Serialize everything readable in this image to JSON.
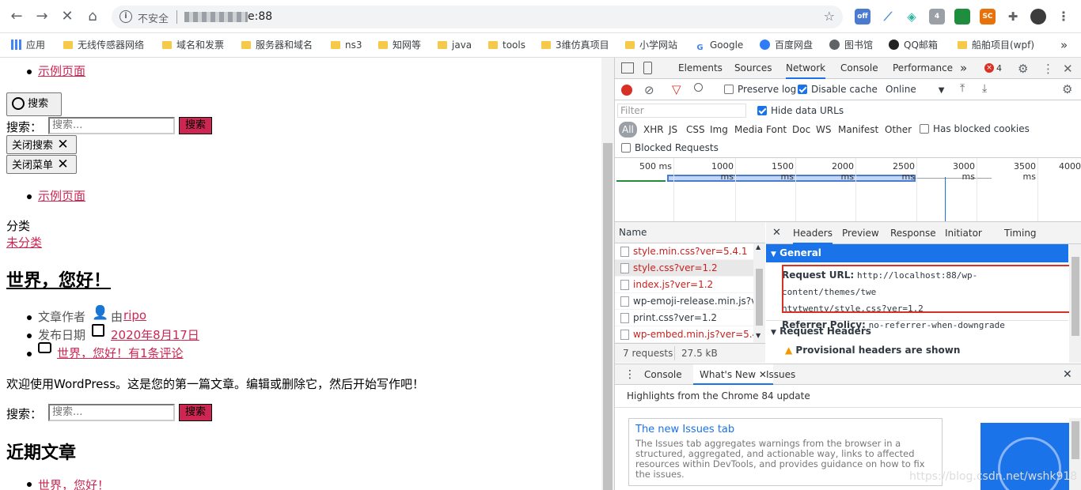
{
  "browser": {
    "insecure_label": "不安全",
    "url_visible": "e:88",
    "bookmarks": [
      {
        "label": "应用",
        "kind": "apps"
      },
      {
        "label": "无线传感器网络",
        "kind": "folder"
      },
      {
        "label": "域名和发票",
        "kind": "folder"
      },
      {
        "label": "服务器和域名",
        "kind": "folder"
      },
      {
        "label": "ns3",
        "kind": "folder"
      },
      {
        "label": "知网等",
        "kind": "folder"
      },
      {
        "label": "java",
        "kind": "folder"
      },
      {
        "label": "tools",
        "kind": "folder"
      },
      {
        "label": "3维仿真项目",
        "kind": "folder"
      },
      {
        "label": "小学网站",
        "kind": "folder"
      },
      {
        "label": "Google",
        "kind": "google"
      },
      {
        "label": "百度网盘",
        "kind": "baidu"
      },
      {
        "label": "图书馆",
        "kind": "globe"
      },
      {
        "label": "QQ邮箱",
        "kind": "qq"
      },
      {
        "label": "船舶项目(wpf)",
        "kind": "folder"
      }
    ],
    "ext_badges": {
      "off": "off",
      "count": "4",
      "sc": "SC"
    }
  },
  "page": {
    "menu_link_1": "示例页面",
    "search_toggle_label": "搜索",
    "search_label": "搜索：",
    "search_placeholder": "搜索...",
    "search_button": "搜索",
    "close_search": "关闭搜索",
    "close_menu": "关闭菜单",
    "menu_link_2": "示例页面",
    "category_label": "分类",
    "category_link": "未分类",
    "post_title": "世界，您好！",
    "meta_author_label": "文章作者",
    "meta_author_prefix": "由",
    "meta_author": "ripo",
    "meta_date_label": "发布日期",
    "meta_date": "2020年8月17日",
    "meta_comments": "世界，您好！有1条评论",
    "post_body": "欢迎使用WordPress。这是您的第一篇文章。编辑或删除它，然后开始写作吧！",
    "search2_label": "搜索：",
    "search2_placeholder": "搜索...",
    "search2_button": "搜索",
    "recent_heading": "近期文章",
    "recent_item_1": "世界，您好！"
  },
  "devtools": {
    "tabs": [
      "Elements",
      "Sources",
      "Network",
      "Console",
      "Performance"
    ],
    "active_tab": "Network",
    "more_tabs": "»",
    "error_count": "4",
    "toolbar": {
      "preserve_log": "Preserve log",
      "disable_cache": "Disable cache",
      "throttling": "Online"
    },
    "filter": {
      "placeholder": "Filter",
      "hide_data_urls": "Hide data URLs",
      "types": [
        "All",
        "XHR",
        "JS",
        "CSS",
        "Img",
        "Media",
        "Font",
        "Doc",
        "WS",
        "Manifest",
        "Other"
      ],
      "has_blocked_cookies": "Has blocked cookies",
      "blocked_requests": "Blocked Requests"
    },
    "timeline_labels": [
      "500 ms",
      "1000 ms",
      "1500 ms",
      "2000 ms",
      "2500 ms",
      "3000 ms",
      "3500 ms",
      "4000"
    ],
    "name_header": "Name",
    "requests": [
      "style.min.css?ver=5.4.1",
      "style.css?ver=1.2",
      "index.js?ver=1.2",
      "wp-emoji-release.min.js?ver...",
      "print.css?ver=1.2",
      "wp-embed.min.js?ver=5.4.1"
    ],
    "status_requests": "7 requests",
    "status_transferred": "27.5 kB transferred",
    "detail_tabs": [
      "Headers",
      "Preview",
      "Response",
      "Initiator",
      "Timing"
    ],
    "general_label": "General",
    "request_url_label": "Request URL:",
    "request_url_value_1": "http://localhost:88/wp-content/themes/twe",
    "request_url_value_2": "ntytwenty/style.css?ver=1.2",
    "referrer_label": "Referrer Policy:",
    "referrer_value": "no-referrer-when-downgrade",
    "request_headers_label": "Request Headers",
    "provisional_text": "Provisional headers are shown",
    "drawer_tabs": [
      "Console",
      "What's New",
      "Issues"
    ],
    "drawer_highlights": "Highlights from the Chrome 84 update",
    "issues_card_title": "The new Issues tab",
    "issues_card_body": "The Issues tab aggregates warnings from the browser in a structured, aggregated, and actionable way, links to affected resources within DevTools, and provides guidance on how to fix the issues.",
    "watermark": "https://blog.csdn.net/wshk918"
  },
  "colors": {
    "wp_accent": "#cd2653",
    "devtools_blue": "#1a73e8",
    "highlight_box": "#d93025"
  }
}
